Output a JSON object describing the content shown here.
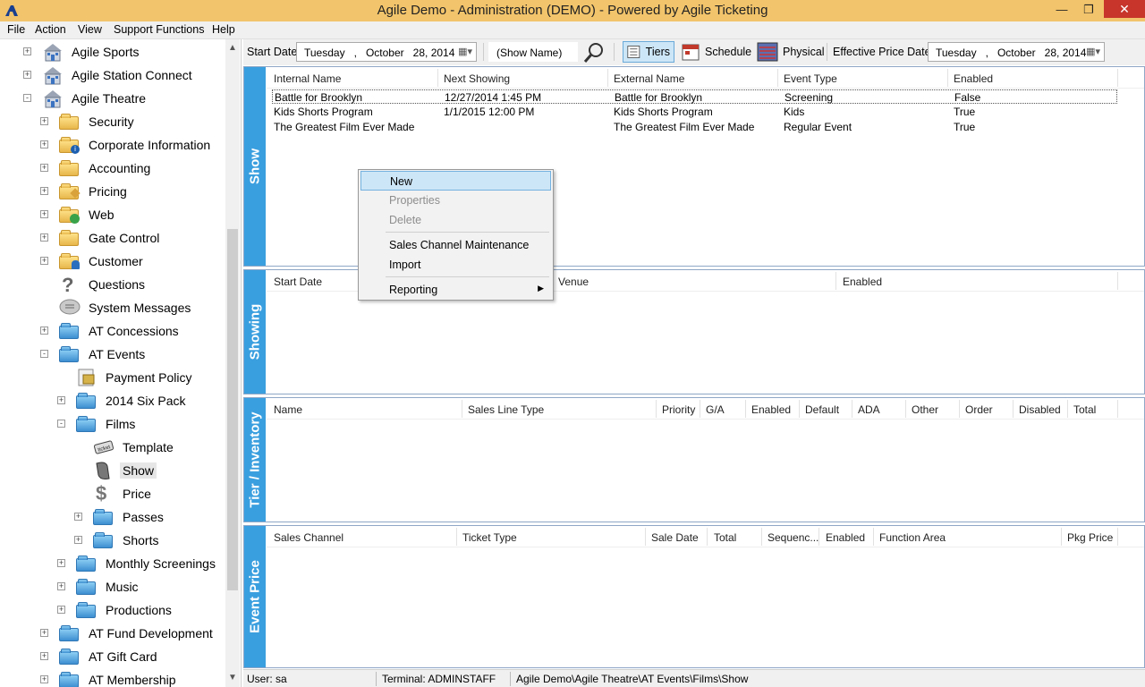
{
  "window": {
    "title": "Agile Demo - Administration (DEMO) - Powered by Agile Ticketing"
  },
  "menu": {
    "items": [
      "File",
      "Action",
      "View",
      "Support Functions",
      "Help"
    ]
  },
  "tree": {
    "items": [
      {
        "label": "Agile Sports",
        "icon": "building-icon"
      },
      {
        "label": "Agile Station Connect",
        "icon": "building-icon"
      },
      {
        "label": "Agile Theatre",
        "icon": "building-icon"
      },
      {
        "label": "Security",
        "icon": "folder-icon"
      },
      {
        "label": "Corporate Information",
        "icon": "folder-icon"
      },
      {
        "label": "Accounting",
        "icon": "folder-icon"
      },
      {
        "label": "Pricing",
        "icon": "folder-icon"
      },
      {
        "label": "Web",
        "icon": "folder-icon"
      },
      {
        "label": "Gate Control",
        "icon": "folder-icon"
      },
      {
        "label": "Customer",
        "icon": "folder-icon"
      },
      {
        "label": "Questions",
        "icon": "question-icon"
      },
      {
        "label": "System Messages",
        "icon": "message-icon"
      },
      {
        "label": "AT Concessions",
        "icon": "folder-icon"
      },
      {
        "label": "AT Events",
        "icon": "folder-icon"
      },
      {
        "label": "Payment Policy",
        "icon": "policy-icon"
      },
      {
        "label": "2014 Six Pack",
        "icon": "folder-icon"
      },
      {
        "label": "Films",
        "icon": "folder-icon"
      },
      {
        "label": "Template",
        "icon": "ticket-icon"
      },
      {
        "label": "Show",
        "icon": "show-icon"
      },
      {
        "label": "Price",
        "icon": "dollar-icon"
      },
      {
        "label": "Passes",
        "icon": "folder-icon"
      },
      {
        "label": "Shorts",
        "icon": "folder-icon"
      },
      {
        "label": "Monthly Screenings",
        "icon": "folder-icon"
      },
      {
        "label": "Music",
        "icon": "folder-icon"
      },
      {
        "label": "Productions",
        "icon": "folder-icon"
      },
      {
        "label": "AT Fund Development",
        "icon": "folder-icon"
      },
      {
        "label": "AT Gift Card",
        "icon": "folder-icon"
      },
      {
        "label": "AT Membership",
        "icon": "folder-icon"
      }
    ]
  },
  "toolbar": {
    "start_date_label": "Start Date",
    "start_date": {
      "day": "Tuesday",
      "sep": ",",
      "month": "October",
      "date": "28, 2014"
    },
    "show_name_placeholder": "(Show Name)",
    "tiers_label": "Tiers",
    "schedule_label": "Schedule",
    "physical_label": "Physical",
    "effective_price_date_label": "Effective Price Date",
    "effective_date": {
      "day": "Tuesday",
      "sep": ",",
      "month": "October",
      "date": "28, 2014"
    }
  },
  "panels": {
    "show": {
      "tab": "Show",
      "columns": [
        "Internal Name",
        "Next Showing",
        "External Name",
        "Event Type",
        "Enabled"
      ],
      "rows": [
        [
          "Battle for Brooklyn",
          "12/27/2014 1:45 PM",
          "Battle for Brooklyn",
          "Screening",
          "False"
        ],
        [
          "Kids Shorts Program",
          "1/1/2015 12:00 PM",
          "Kids Shorts Program",
          "Kids",
          "True"
        ],
        [
          "The Greatest Film Ever Made",
          "",
          "The Greatest Film Ever Made",
          "Regular Event",
          "True"
        ]
      ]
    },
    "showing": {
      "tab": "Showing",
      "columns": [
        "Start Date",
        "Venue",
        "Enabled"
      ]
    },
    "tier": {
      "tab": "Tier / Inventory",
      "columns": [
        "Name",
        "Sales Line Type",
        "Priority",
        "G/A",
        "Enabled",
        "Default",
        "ADA",
        "Other",
        "Order",
        "Disabled",
        "Total"
      ]
    },
    "event_price": {
      "tab": "Event Price",
      "columns": [
        "Sales Channel",
        "Ticket Type",
        "Sale Date",
        "Total",
        "Sequenc...",
        "Enabled",
        "Function Area",
        "Pkg Price"
      ]
    }
  },
  "context_menu": {
    "new": "New",
    "properties": "Properties",
    "delete": "Delete",
    "sales_channel": "Sales Channel Maintenance",
    "import": "Import",
    "reporting": "Reporting"
  },
  "status": {
    "user": "User:  sa",
    "terminal": "Terminal:  ADMINSTAFF",
    "path": "Agile Demo\\Agile Theatre\\AT Events\\Films\\Show"
  }
}
